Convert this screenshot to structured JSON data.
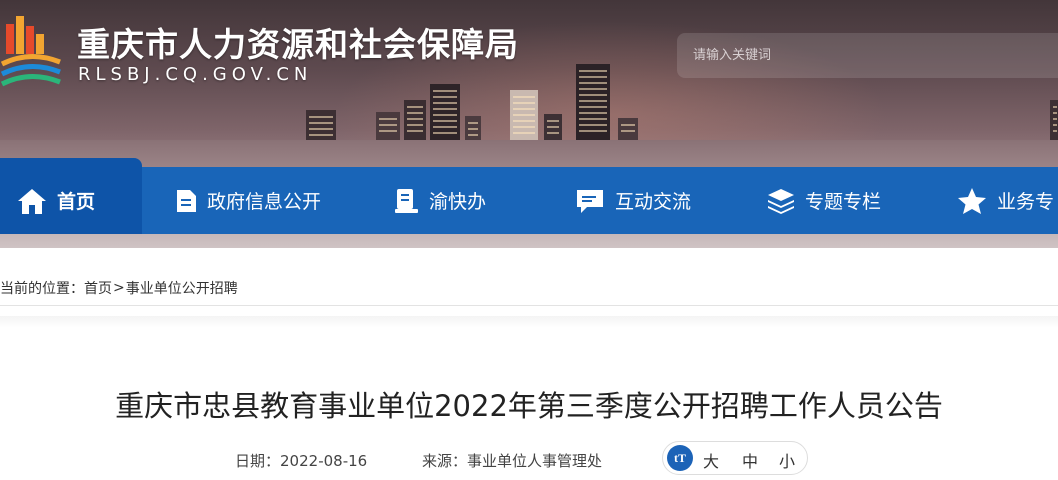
{
  "site": {
    "title": "重庆市人力资源和社会保障局",
    "url": "RLSBJ.CQ.GOV.CN"
  },
  "search": {
    "placeholder": "请输入关键词"
  },
  "nav": {
    "items": [
      {
        "label": "首页",
        "icon": "home-icon",
        "active": true
      },
      {
        "label": "政府信息公开",
        "icon": "document-icon"
      },
      {
        "label": "渝快办",
        "icon": "handbook-icon"
      },
      {
        "label": "互动交流",
        "icon": "chat-icon"
      },
      {
        "label": "专题专栏",
        "icon": "layers-icon"
      },
      {
        "label": "业务专",
        "icon": "star-icon"
      }
    ]
  },
  "breadcrumb": {
    "prefix": "您当前的位置：",
    "items": [
      "首页",
      "事业单位公开招聘"
    ],
    "separator": ">"
  },
  "article": {
    "title": "重庆市忠县教育事业单位2022年第三季度公开招聘工作人员公告",
    "date_label": "日期：",
    "date": "2022-08-16",
    "source_label": "来源：",
    "source": "事业单位人事管理处"
  },
  "font_size": {
    "icon_label": "tT",
    "large": "大",
    "medium": "中",
    "small": "小"
  },
  "colors": {
    "nav_bg": "#1965b8",
    "nav_active": "#0e54a8",
    "accent": "#1c63b7"
  }
}
